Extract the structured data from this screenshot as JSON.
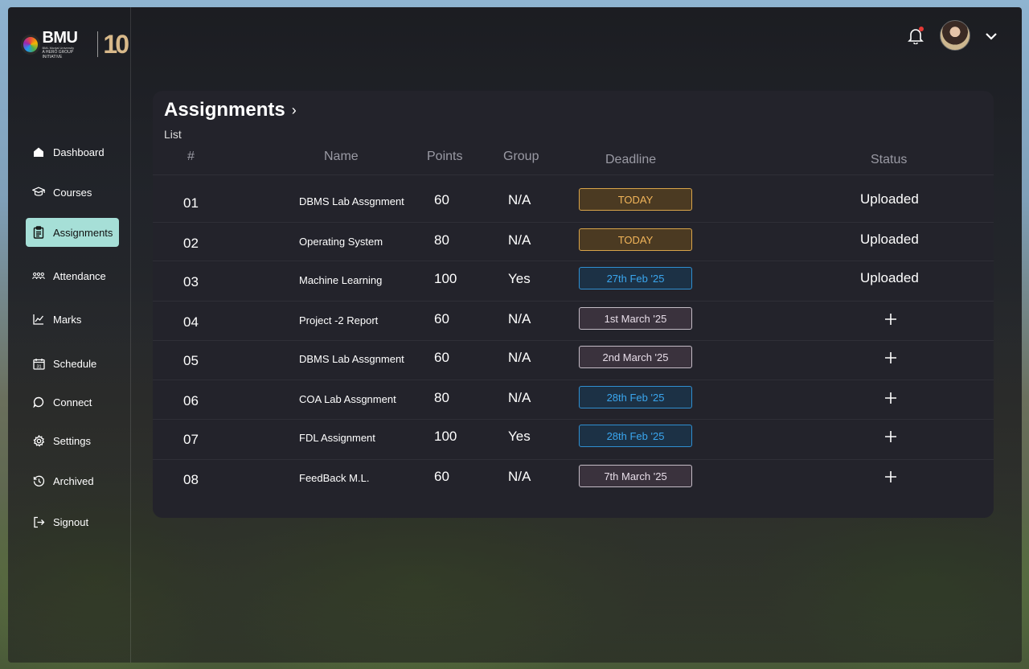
{
  "logo": {
    "brand": "BMU",
    "sub": "BML Munjal University",
    "tag": "A HERO GROUP INITIATIVE",
    "anniversary": "10"
  },
  "sidebar": {
    "items": [
      {
        "label": "Dashboard",
        "icon": "home-icon"
      },
      {
        "label": "Courses",
        "icon": "graduation-cap-icon"
      },
      {
        "label": "Assignments",
        "icon": "clipboard-icon",
        "active": true
      },
      {
        "label": "Attendance",
        "icon": "people-icon"
      },
      {
        "label": "Marks",
        "icon": "chart-line-icon"
      },
      {
        "label": "Schedule",
        "icon": "calendar-icon"
      },
      {
        "label": "Connect",
        "icon": "chat-bubble-icon"
      },
      {
        "label": "Settings",
        "icon": "gear-icon"
      },
      {
        "label": "Archived",
        "icon": "history-icon"
      },
      {
        "label": "Signout",
        "icon": "signout-icon"
      }
    ]
  },
  "header": {
    "notification_icon": "bell-icon",
    "has_notification": true
  },
  "page": {
    "title": "Assignments",
    "subtitle": "List"
  },
  "table": {
    "headers": {
      "num": "#",
      "name": "Name",
      "points": "Points",
      "group": "Group",
      "deadline": "Deadline",
      "status": "Status"
    },
    "rows": [
      {
        "num": "01",
        "name": "DBMS Lab Assgnment",
        "points": "60",
        "group": "N/A",
        "deadline": "TODAY",
        "deadline_style": "today",
        "status": "Uploaded"
      },
      {
        "num": "02",
        "name": "Operating System",
        "points": "80",
        "group": "N/A",
        "deadline": "TODAY",
        "deadline_style": "today",
        "status": "Uploaded"
      },
      {
        "num": "03",
        "name": "Machine Learning",
        "points": "100",
        "group": "Yes",
        "deadline": "27th Feb '25",
        "deadline_style": "blue",
        "status": "Uploaded"
      },
      {
        "num": "04",
        "name": "Project -2 Report",
        "points": "60",
        "group": "N/A",
        "deadline": "1st March  '25",
        "deadline_style": "plain",
        "status": null
      },
      {
        "num": "05",
        "name": "DBMS Lab Assgnment",
        "points": "60",
        "group": "N/A",
        "deadline": "2nd March  '25",
        "deadline_style": "plain",
        "status": null
      },
      {
        "num": "06",
        "name": "COA Lab Assgnment",
        "points": "80",
        "group": "N/A",
        "deadline": "28th Feb '25",
        "deadline_style": "blue",
        "status": null
      },
      {
        "num": "07",
        "name": "FDL Assignment",
        "points": "100",
        "group": "Yes",
        "deadline": "28th Feb '25",
        "deadline_style": "blue",
        "status": null
      },
      {
        "num": "08",
        "name": "FeedBack M.L.",
        "points": "60",
        "group": "N/A",
        "deadline": "7th March  '25",
        "deadline_style": "plain",
        "status": null
      }
    ]
  },
  "colors": {
    "active_nav": "#a6dfd7",
    "today_badge": "#f2b55a",
    "blue_badge": "#3aa6ee",
    "panel": "#23232b"
  }
}
